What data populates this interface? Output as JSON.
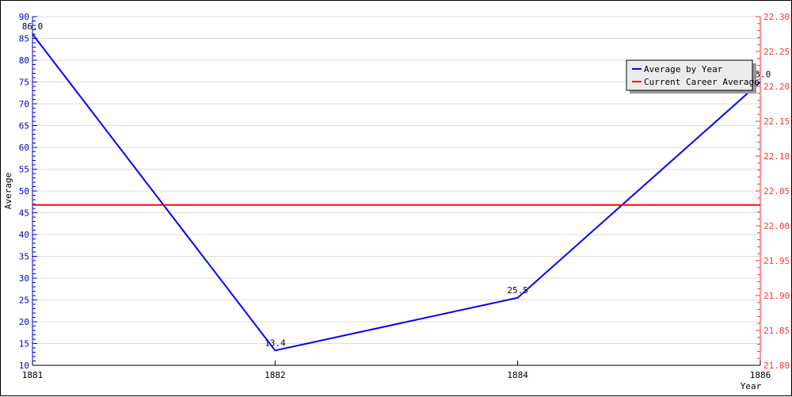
{
  "chart_data": {
    "type": "line",
    "title": "",
    "xlabel": "Year",
    "ylabel": "Average",
    "y2label": "",
    "x_ticks": [
      "1881",
      "1882",
      "1884",
      "1886"
    ],
    "ylim": [
      10,
      90
    ],
    "y_ticks": [
      10,
      15,
      20,
      25,
      30,
      35,
      40,
      45,
      50,
      55,
      60,
      65,
      70,
      75,
      80,
      85,
      90
    ],
    "y2lim": [
      21.8,
      22.3
    ],
    "y2_ticks": [
      "21.80",
      "21.85",
      "21.90",
      "21.95",
      "22.00",
      "22.05",
      "22.10",
      "22.15",
      "22.20",
      "22.25",
      "22.30"
    ],
    "grid": true,
    "legend_position": "top-right",
    "series": [
      {
        "name": "Average by Year",
        "color": "#0000ff",
        "axis": "left",
        "x": [
          "1881",
          "1882",
          "1884",
          "1886"
        ],
        "values": [
          86.0,
          13.4,
          25.5,
          75.0
        ],
        "labels": [
          "86.0",
          "13.4",
          "25.5",
          "75.0"
        ]
      },
      {
        "name": "Current Career Average",
        "color": "#ff0000",
        "axis": "right",
        "value": 22.03
      }
    ]
  }
}
